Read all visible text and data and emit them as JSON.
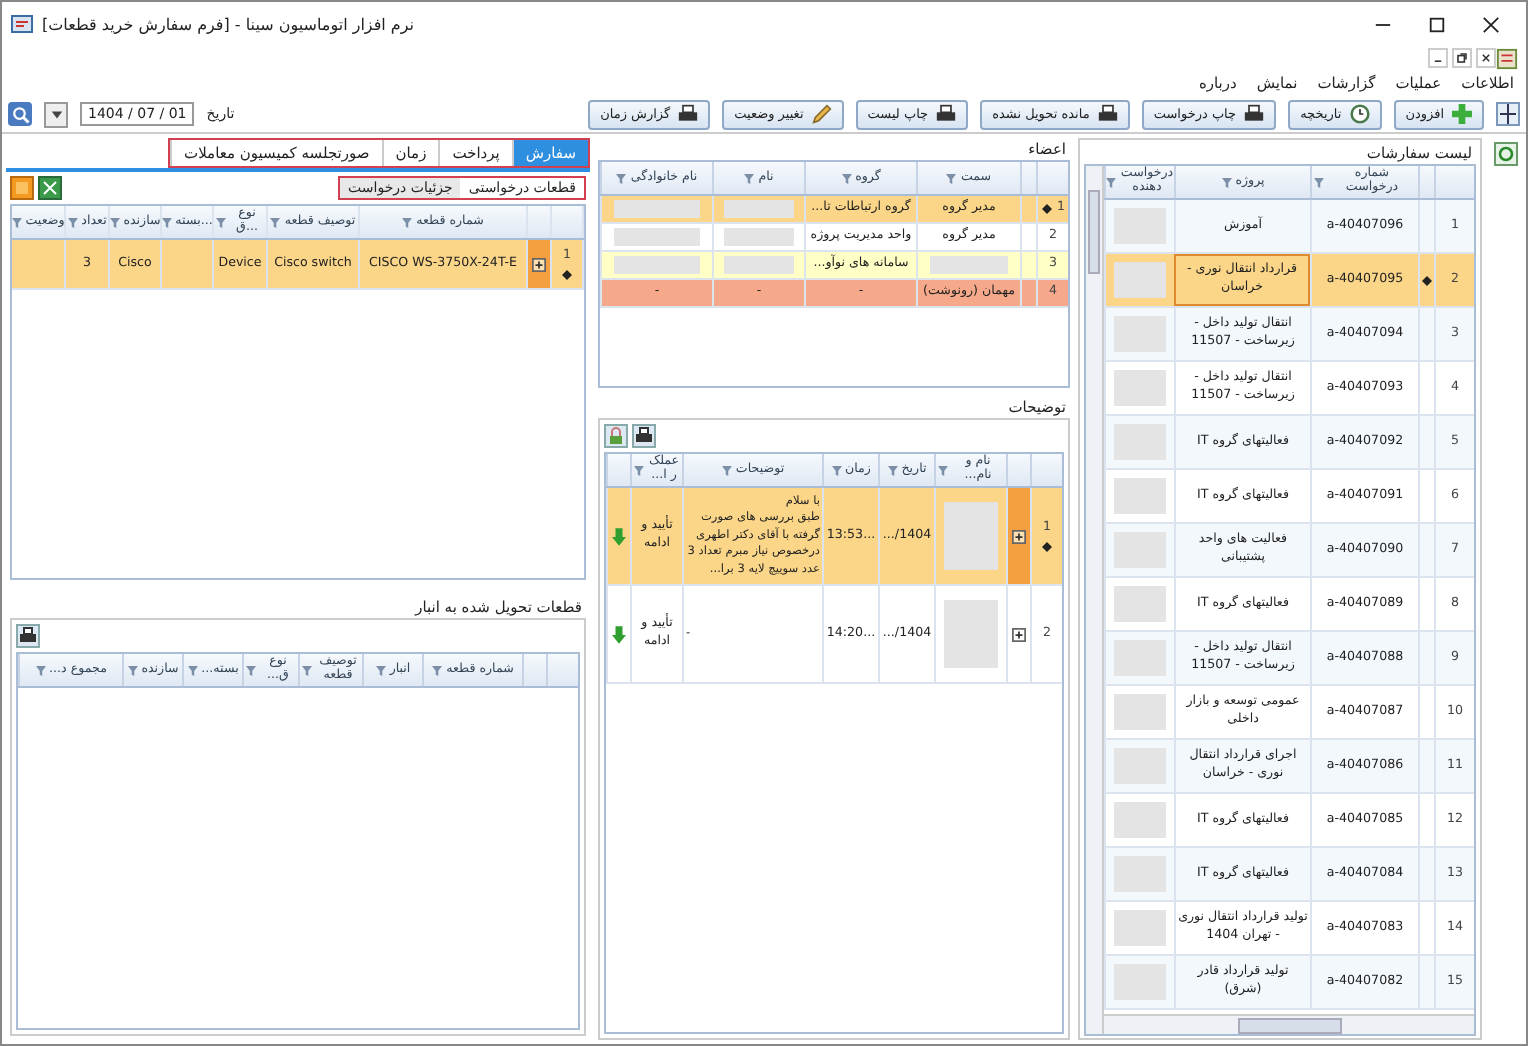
{
  "window": {
    "title": "نرم افزار اتوماسیون سینا - [فرم سفارش خرید قطعات]"
  },
  "menu": [
    "اطلاعات",
    "عملیات",
    "گزارشات",
    "نمایش",
    "درباره"
  ],
  "toolbar": {
    "buttons": [
      {
        "label": "افزودن",
        "kind": "add"
      },
      {
        "label": "تاریخچه",
        "kind": "history"
      },
      {
        "label": "چاپ درخواست",
        "kind": "print"
      },
      {
        "label": "مانده تحویل نشده",
        "kind": "print"
      },
      {
        "label": "چاپ لیست",
        "kind": "print"
      },
      {
        "label": "تغییر وضعیت",
        "kind": "edit"
      },
      {
        "label": "گزارش زمان",
        "kind": "print"
      }
    ],
    "date_label": "تاریخ",
    "date_value": "1404 / 07 / 01"
  },
  "orders": {
    "title": "لیست سفارشات",
    "columns": [
      "شماره درخواست",
      "پروژه",
      "درخواست دهنده"
    ],
    "rows": [
      {
        "index": "1",
        "number": "a-40407096",
        "project": "آموزش",
        "requester": null,
        "selected": false
      },
      {
        "index": "2",
        "number": "a-40407095",
        "project": "قرارداد انتقال نوری - خراسان",
        "requester": null,
        "selected": true
      },
      {
        "index": "3",
        "number": "a-40407094",
        "project": "انتقال تولید داخل - زیرساخت - 11507",
        "requester": null,
        "selected": false
      },
      {
        "index": "4",
        "number": "a-40407093",
        "project": "انتقال تولید داخل - زیرساخت - 11507",
        "requester": null,
        "selected": false
      },
      {
        "index": "5",
        "number": "a-40407092",
        "project": "فعالیتهای گروه IT",
        "requester": null,
        "selected": false
      },
      {
        "index": "6",
        "number": "a-40407091",
        "project": "فعالیتهای گروه IT",
        "requester": null,
        "selected": false
      },
      {
        "index": "7",
        "number": "a-40407090",
        "project": "فعالیت های واحد پشتیبانی",
        "requester": null,
        "selected": false
      },
      {
        "index": "8",
        "number": "a-40407089",
        "project": "فعالیتهای گروه IT",
        "requester": null,
        "selected": false
      },
      {
        "index": "9",
        "number": "a-40407088",
        "project": "انتقال تولید داخل - زیرساخت - 11507",
        "requester": null,
        "selected": false
      },
      {
        "index": "10",
        "number": "a-40407087",
        "project": "عمومی توسعه و بازار داخلی",
        "requester": null,
        "selected": false
      },
      {
        "index": "11",
        "number": "a-40407086",
        "project": "اجرای قرارداد انتقال نوری - خراسان",
        "requester": null,
        "selected": false
      },
      {
        "index": "12",
        "number": "a-40407085",
        "project": "فعالیتهای گروه IT",
        "requester": null,
        "selected": false
      },
      {
        "index": "13",
        "number": "a-40407084",
        "project": "فعالیتهای گروه IT",
        "requester": null,
        "selected": false
      },
      {
        "index": "14",
        "number": "a-40407083",
        "project": "تولید قرارداد انتقال نوری - تهران 1404",
        "requester": null,
        "selected": false
      },
      {
        "index": "15",
        "number": "a-40407082",
        "project": "تولید قرارداد قادر (شرق)",
        "requester": null,
        "selected": false
      }
    ]
  },
  "members": {
    "title": "اعضاء",
    "columns": [
      "سمت",
      "گروه",
      "نام",
      "نام خانوادگی"
    ],
    "rows": [
      {
        "index": "1",
        "position": "مدیر گروه",
        "group": "گروه ارتباطات تا...",
        "name": null,
        "surname": null,
        "color": "#fbd688",
        "selected": true
      },
      {
        "index": "2",
        "position": "مدیر گروه",
        "group": "واحد مدیریت پروژه",
        "name": null,
        "surname": null,
        "color": "#ffffff",
        "selected": false
      },
      {
        "index": "3",
        "position": null,
        "group": "سامانه های نوآو...",
        "name": null,
        "surname": null,
        "color": "#ffffc6",
        "selected": false
      },
      {
        "index": "4",
        "position": "مهمان (رونوشت)",
        "group": "-",
        "name": "-",
        "surname": "-",
        "color": "#f6a98a",
        "selected": false
      }
    ]
  },
  "notes": {
    "title": "توضیحات",
    "columns": [
      "نام و نام...",
      "تاریخ",
      "زمان",
      "توضیحات",
      "عملک ر ا..."
    ],
    "rows": [
      {
        "index": "1",
        "name": null,
        "date": "1404/...",
        "time": "...13:53",
        "text": "با سلام\nطبق بررسی های صورت گرفته با آقای دکتر اطهری درخصوص نیاز مبرم تعداد 3 عدد سوییچ لایه 3 برا...",
        "action": "تأیید و ادامه",
        "selected": true
      },
      {
        "index": "2",
        "name": null,
        "date": "1404/...",
        "time": "...14:20",
        "text": "-",
        "action": "تأیید و ادامه",
        "selected": false
      }
    ]
  },
  "tabs": [
    {
      "label": "سفارش",
      "selected": true
    },
    {
      "label": "پرداخت",
      "selected": false
    },
    {
      "label": "زمان",
      "selected": false
    },
    {
      "label": "صورتجلسه کمیسیون معاملات",
      "selected": false
    }
  ],
  "subtabs": [
    {
      "label": "قطعات درخواستی",
      "selected": true
    },
    {
      "label": "جزئیات درخواست",
      "selected": false
    }
  ],
  "parts": {
    "columns": [
      "شماره قطعه",
      "توصیف قطعه",
      "نوع ق...",
      "بسته...",
      "سازنده",
      "تعداد",
      "وضعیت"
    ],
    "rows": [
      {
        "index": "1",
        "cells": [
          "CISCO WS-3750X-24T-E",
          "Cisco switch",
          "Device",
          null,
          "Cisco",
          "3",
          null
        ],
        "selected": true
      }
    ]
  },
  "delivered": {
    "title": "قطعات تحویل شده به انبار",
    "columns": [
      "شماره قطعه",
      "انبار",
      "توصیف قطعه",
      "نوع ق...",
      "بسته...",
      "سازنده",
      "مجموع د..."
    ]
  }
}
